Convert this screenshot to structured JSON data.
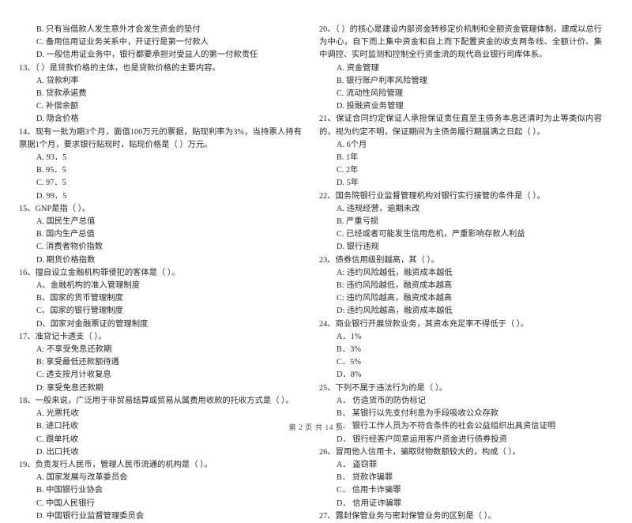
{
  "document": {
    "page_label": "第 2 页 共 14 页",
    "page_number": "2",
    "total_pages": "14"
  },
  "left_column": {
    "items": [
      {
        "kind": "option",
        "name": "q12-option-b",
        "text": "B. 只有当借款人发生意外才会发生资金的垫付"
      },
      {
        "kind": "option",
        "name": "q12-option-c",
        "text": "C. 备用信用证业务关系中，开证行是第一付款人"
      },
      {
        "kind": "option",
        "name": "q12-option-d",
        "text": "D. 一般信用证业务中，银行都要承担对受益人的第一付款责任"
      },
      {
        "kind": "stem",
        "name": "question-13-stem",
        "text": "13、（        ）是贷款价格的主体，也是贷款价格的主要内容。"
      },
      {
        "kind": "option",
        "name": "q13-option-a",
        "text": "A. 贷款利率"
      },
      {
        "kind": "option",
        "name": "q13-option-b",
        "text": "B. 贷款承诺费"
      },
      {
        "kind": "option",
        "name": "q13-option-c",
        "text": "C. 补偿余额"
      },
      {
        "kind": "option",
        "name": "q13-option-d",
        "text": "D. 隐含价格"
      },
      {
        "kind": "stem",
        "name": "question-14-stem",
        "text": "14、现有一批为期3个月，面值100万元的票据，贴现利率为3%，当持票人持有票据1个月，要求银行贴现时，贴现价格是（  ）万元。"
      },
      {
        "kind": "option",
        "name": "q14-option-a",
        "text": "A. 93．5"
      },
      {
        "kind": "option",
        "name": "q14-option-b",
        "text": "B. 95．5"
      },
      {
        "kind": "option",
        "name": "q14-option-c",
        "text": "C. 97．5"
      },
      {
        "kind": "option",
        "name": "q14-option-d",
        "text": "D. 99．5"
      },
      {
        "kind": "stem",
        "name": "question-15-stem",
        "text": "15、GNP是指（        ）。"
      },
      {
        "kind": "option",
        "name": "q15-option-a",
        "text": "A. 国民生产总值"
      },
      {
        "kind": "option",
        "name": "q15-option-b",
        "text": "B. 国内生产总值"
      },
      {
        "kind": "option",
        "name": "q15-option-c",
        "text": "C. 消费者物价指数"
      },
      {
        "kind": "option",
        "name": "q15-option-d",
        "text": "D. 期货价格指数"
      },
      {
        "kind": "stem",
        "name": "question-16-stem",
        "text": "16、擅自设立金融机构罪侵犯的客体是（        ）。"
      },
      {
        "kind": "option",
        "name": "q16-option-a",
        "text": "A、金融机构的准入管理制度"
      },
      {
        "kind": "option",
        "name": "q16-option-b",
        "text": "B、国家的货币管理制度"
      },
      {
        "kind": "option",
        "name": "q16-option-c",
        "text": "C、国家的银行管理制度"
      },
      {
        "kind": "option",
        "name": "q16-option-d",
        "text": "D、国家对金融票证的管理制度"
      },
      {
        "kind": "stem",
        "name": "question-17-stem",
        "text": "17、准贷记卡透支（        ）。"
      },
      {
        "kind": "option",
        "name": "q17-option-a",
        "text": "A: 不享受免息还款期"
      },
      {
        "kind": "option",
        "name": "q17-option-b",
        "text": "B: 享受最低还款额待遇"
      },
      {
        "kind": "option",
        "name": "q17-option-c",
        "text": "C: 透支按月计收复息"
      },
      {
        "kind": "option",
        "name": "q17-option-d",
        "text": "D: 享受免息还款期"
      },
      {
        "kind": "stem",
        "name": "question-18-stem",
        "text": "18、一般来说，广泛用于非贸易结算或贸易从属费用收款的托收方式是（        ）。"
      },
      {
        "kind": "option",
        "name": "q18-option-a",
        "text": "A. 光票托收"
      },
      {
        "kind": "option",
        "name": "q18-option-b",
        "text": "B. 进口托收"
      },
      {
        "kind": "option",
        "name": "q18-option-c",
        "text": "C. 跟单托收"
      },
      {
        "kind": "option",
        "name": "q18-option-d",
        "text": "D. 出口托收"
      },
      {
        "kind": "stem",
        "name": "question-19-stem",
        "text": "19、负责发行人民币，管理人民币流通的机构是（        ）。"
      },
      {
        "kind": "option",
        "name": "q19-option-a",
        "text": "A. 国家发展与改革委员会"
      },
      {
        "kind": "option",
        "name": "q19-option-b",
        "text": "B. 中国银行业协会"
      },
      {
        "kind": "option",
        "name": "q19-option-c",
        "text": "C. 中国人民银行"
      },
      {
        "kind": "option",
        "name": "q19-option-d",
        "text": "D. 中国银行业监督管理委员会"
      }
    ]
  },
  "right_column": {
    "items": [
      {
        "kind": "stem",
        "name": "question-20-stem",
        "text": "20、（        ）的核心是建设内部资金转移定价机制和全额资金管理体制，建成以总行为中心，自下而上集中资金和自上而下配置资金的收支两条线、全额计价、集中调控、实时监测和控制全行资金流的现代商业银行司库体系。"
      },
      {
        "kind": "option",
        "name": "q20-option-a",
        "text": "A. 资金管理"
      },
      {
        "kind": "option",
        "name": "q20-option-b",
        "text": "B. 银行账户利率风险管理"
      },
      {
        "kind": "option",
        "name": "q20-option-c",
        "text": "C. 流动性风险管理"
      },
      {
        "kind": "option",
        "name": "q20-option-d",
        "text": "D. 投融资业务管理"
      },
      {
        "kind": "stem",
        "name": "question-21-stem",
        "text": "21、保证合同约定保证人承担保证责任直至主债务本息还清时为止等类似内容的，视为约定不明，保证期间为主债务履行期届满之日起（        ）。"
      },
      {
        "kind": "option",
        "name": "q21-option-a",
        "text": "A. 6个月"
      },
      {
        "kind": "option",
        "name": "q21-option-b",
        "text": "B. 1年"
      },
      {
        "kind": "option",
        "name": "q21-option-c",
        "text": "C. 2年"
      },
      {
        "kind": "option",
        "name": "q21-option-d",
        "text": "D. 5年"
      },
      {
        "kind": "stem",
        "name": "question-22-stem",
        "text": "22、国务院银行业监督管理机构对银行实行接管的条件是（        ）。"
      },
      {
        "kind": "option",
        "name": "q22-option-a",
        "text": "A. 违规经营，逾期未改"
      },
      {
        "kind": "option",
        "name": "q22-option-b",
        "text": "B. 严重亏损"
      },
      {
        "kind": "option",
        "name": "q22-option-c",
        "text": "C. 已经或者可能发生信用危机，严重影响存款人利益"
      },
      {
        "kind": "option",
        "name": "q22-option-d",
        "text": "D. 银行违规"
      },
      {
        "kind": "stem",
        "name": "question-23-stem",
        "text": "23、债券信用级别越高，其（        ）。"
      },
      {
        "kind": "option",
        "name": "q23-option-a",
        "text": "A: 违约风险越低，融资成本越低"
      },
      {
        "kind": "option",
        "name": "q23-option-b",
        "text": "B: 违约风险越低，融资成本越高"
      },
      {
        "kind": "option",
        "name": "q23-option-c",
        "text": "C: 违约风险越高，融资成本越高"
      },
      {
        "kind": "option",
        "name": "q23-option-d",
        "text": "D: 违约风险越高，融资成本越低"
      },
      {
        "kind": "stem",
        "name": "question-24-stem",
        "text": "24、商业银行开展贷款业务，其资本充足率不得低于（        ）。"
      },
      {
        "kind": "option",
        "name": "q24-option-a",
        "text": "A．1%"
      },
      {
        "kind": "option",
        "name": "q24-option-b",
        "text": "B．3%"
      },
      {
        "kind": "option",
        "name": "q24-option-c",
        "text": "C．5%"
      },
      {
        "kind": "option",
        "name": "q24-option-d",
        "text": "D．8%"
      },
      {
        "kind": "stem",
        "name": "question-25-stem",
        "text": "25、下列不属于违法行为的是（        ）。"
      },
      {
        "kind": "option",
        "name": "q25-option-a",
        "text": "A． 仿造货币的防伪标记"
      },
      {
        "kind": "option",
        "name": "q25-option-b",
        "text": "B． 某银行以先支付利息为手段吸收公众存款"
      },
      {
        "kind": "option",
        "name": "q25-option-c",
        "text": "C． 银行工作人员为不符合条件的社会公益组织出具资信证明"
      },
      {
        "kind": "option",
        "name": "q25-option-d",
        "text": "D． 银行经客户同意运用客户资金进行债券投资"
      },
      {
        "kind": "stem",
        "name": "question-26-stem",
        "text": "26、冒用他人信用卡，骗取财物数额较大的，构成（        ）。"
      },
      {
        "kind": "option",
        "name": "q26-option-a",
        "text": "A． 盗窃罪"
      },
      {
        "kind": "option",
        "name": "q26-option-b",
        "text": "B． 贷款诈骗罪"
      },
      {
        "kind": "option",
        "name": "q26-option-c",
        "text": "C． 信用卡诈骗罪"
      },
      {
        "kind": "option",
        "name": "q26-option-d",
        "text": "D． 信用证诈骗罪"
      },
      {
        "kind": "stem",
        "name": "question-27-stem",
        "text": "27、露封保管业务与密封保管业务的区别是（        ）。"
      }
    ]
  }
}
